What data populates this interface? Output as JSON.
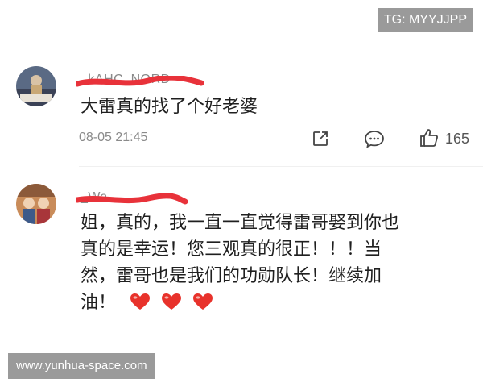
{
  "watermarks": {
    "top_right": "TG: MYYJJPP",
    "bottom_left": "www.yunhua-space.com"
  },
  "comments": [
    {
      "username": "_kAHC_NORD",
      "avatar": "avatar-photo",
      "text": "大雷真的找了个好老婆",
      "timestamp": "08-05 21:45",
      "like_count": "165",
      "actions": [
        "share-icon",
        "comment-icon",
        "like-icon"
      ]
    },
    {
      "username": "_Wa",
      "avatar": "avatar-photo",
      "text_lines": [
        "姐，真的，我一直一直觉得雷哥娶到你也",
        "真的是幸运！您三观真的很正！！！当",
        "然，雷哥也是我们的功勋队长！继续加",
        "油！"
      ],
      "emoji": [
        "red-heart",
        "red-heart",
        "red-heart"
      ]
    }
  ],
  "colors": {
    "redaction": "#e8323a",
    "heart": "#e8322b",
    "muted_text": "#8a8a8a",
    "watermark_bg": "#9a9a9a"
  }
}
